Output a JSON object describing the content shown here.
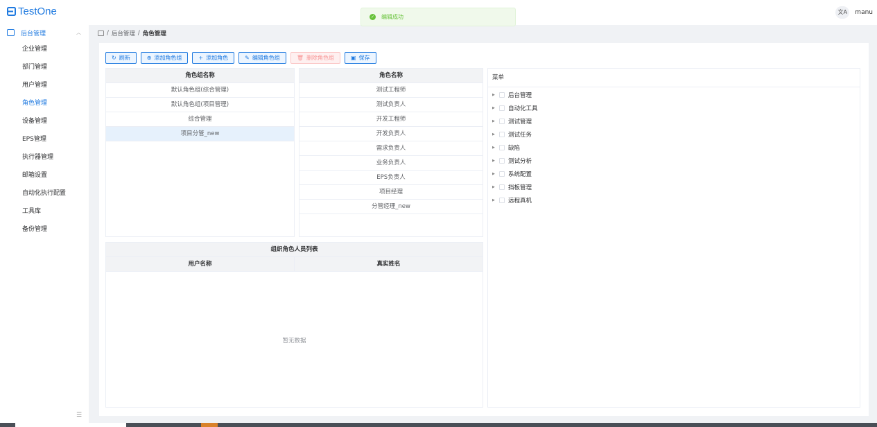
{
  "app": {
    "name": "TestOne"
  },
  "topbar": {
    "translate_icon": "文A",
    "username": "manu"
  },
  "toast": {
    "message": "编辑成功"
  },
  "sidebar": {
    "group_label": "后台管理",
    "items": [
      {
        "label": "企业管理",
        "active": false
      },
      {
        "label": "部门管理",
        "active": false
      },
      {
        "label": "用户管理",
        "active": false
      },
      {
        "label": "角色管理",
        "active": true
      },
      {
        "label": "设备管理",
        "active": false
      },
      {
        "label": "EPS管理",
        "active": false
      },
      {
        "label": "执行器管理",
        "active": false
      },
      {
        "label": "邮箱设置",
        "active": false
      },
      {
        "label": "自动化执行配置",
        "active": false
      },
      {
        "label": "工具库",
        "active": false
      },
      {
        "label": "备份管理",
        "active": false
      }
    ]
  },
  "breadcrumb": {
    "parent": "后台管理",
    "current": "角色管理",
    "separator": "/"
  },
  "toolbar": {
    "refresh": "刷新",
    "add_group": "添加角色组",
    "add_role": "添加角色",
    "edit_group": "编辑角色组",
    "delete_group": "删除角色组",
    "save": "保存"
  },
  "role_groups": {
    "header": "角色组名称",
    "rows": [
      "默认角色组(综合管理)",
      "默认角色组(项目管理)",
      "综合管理",
      "项目分管_new"
    ],
    "selected_index": 3
  },
  "roles": {
    "header": "角色名称",
    "rows": [
      "测试工程师",
      "测试负责人",
      "开发工程师",
      "开发负责人",
      "需求负责人",
      "业务负责人",
      "EPS负责人",
      "项目经理",
      "分管经理_new"
    ]
  },
  "members": {
    "title": "组织角色人员列表",
    "col_username": "用户名称",
    "col_realname": "真实姓名",
    "empty_text": "暂无数据"
  },
  "menu": {
    "header": "菜单",
    "nodes": [
      "后台管理",
      "自动化工具",
      "测试管理",
      "测试任务",
      "缺陷",
      "测试分析",
      "系统配置",
      "挡板管理",
      "远程真机"
    ]
  },
  "colors": {
    "primary": "#1f7ae0",
    "success": "#67c23a",
    "danger_light": "#f89898",
    "selected_row": "#e6f1fc"
  }
}
